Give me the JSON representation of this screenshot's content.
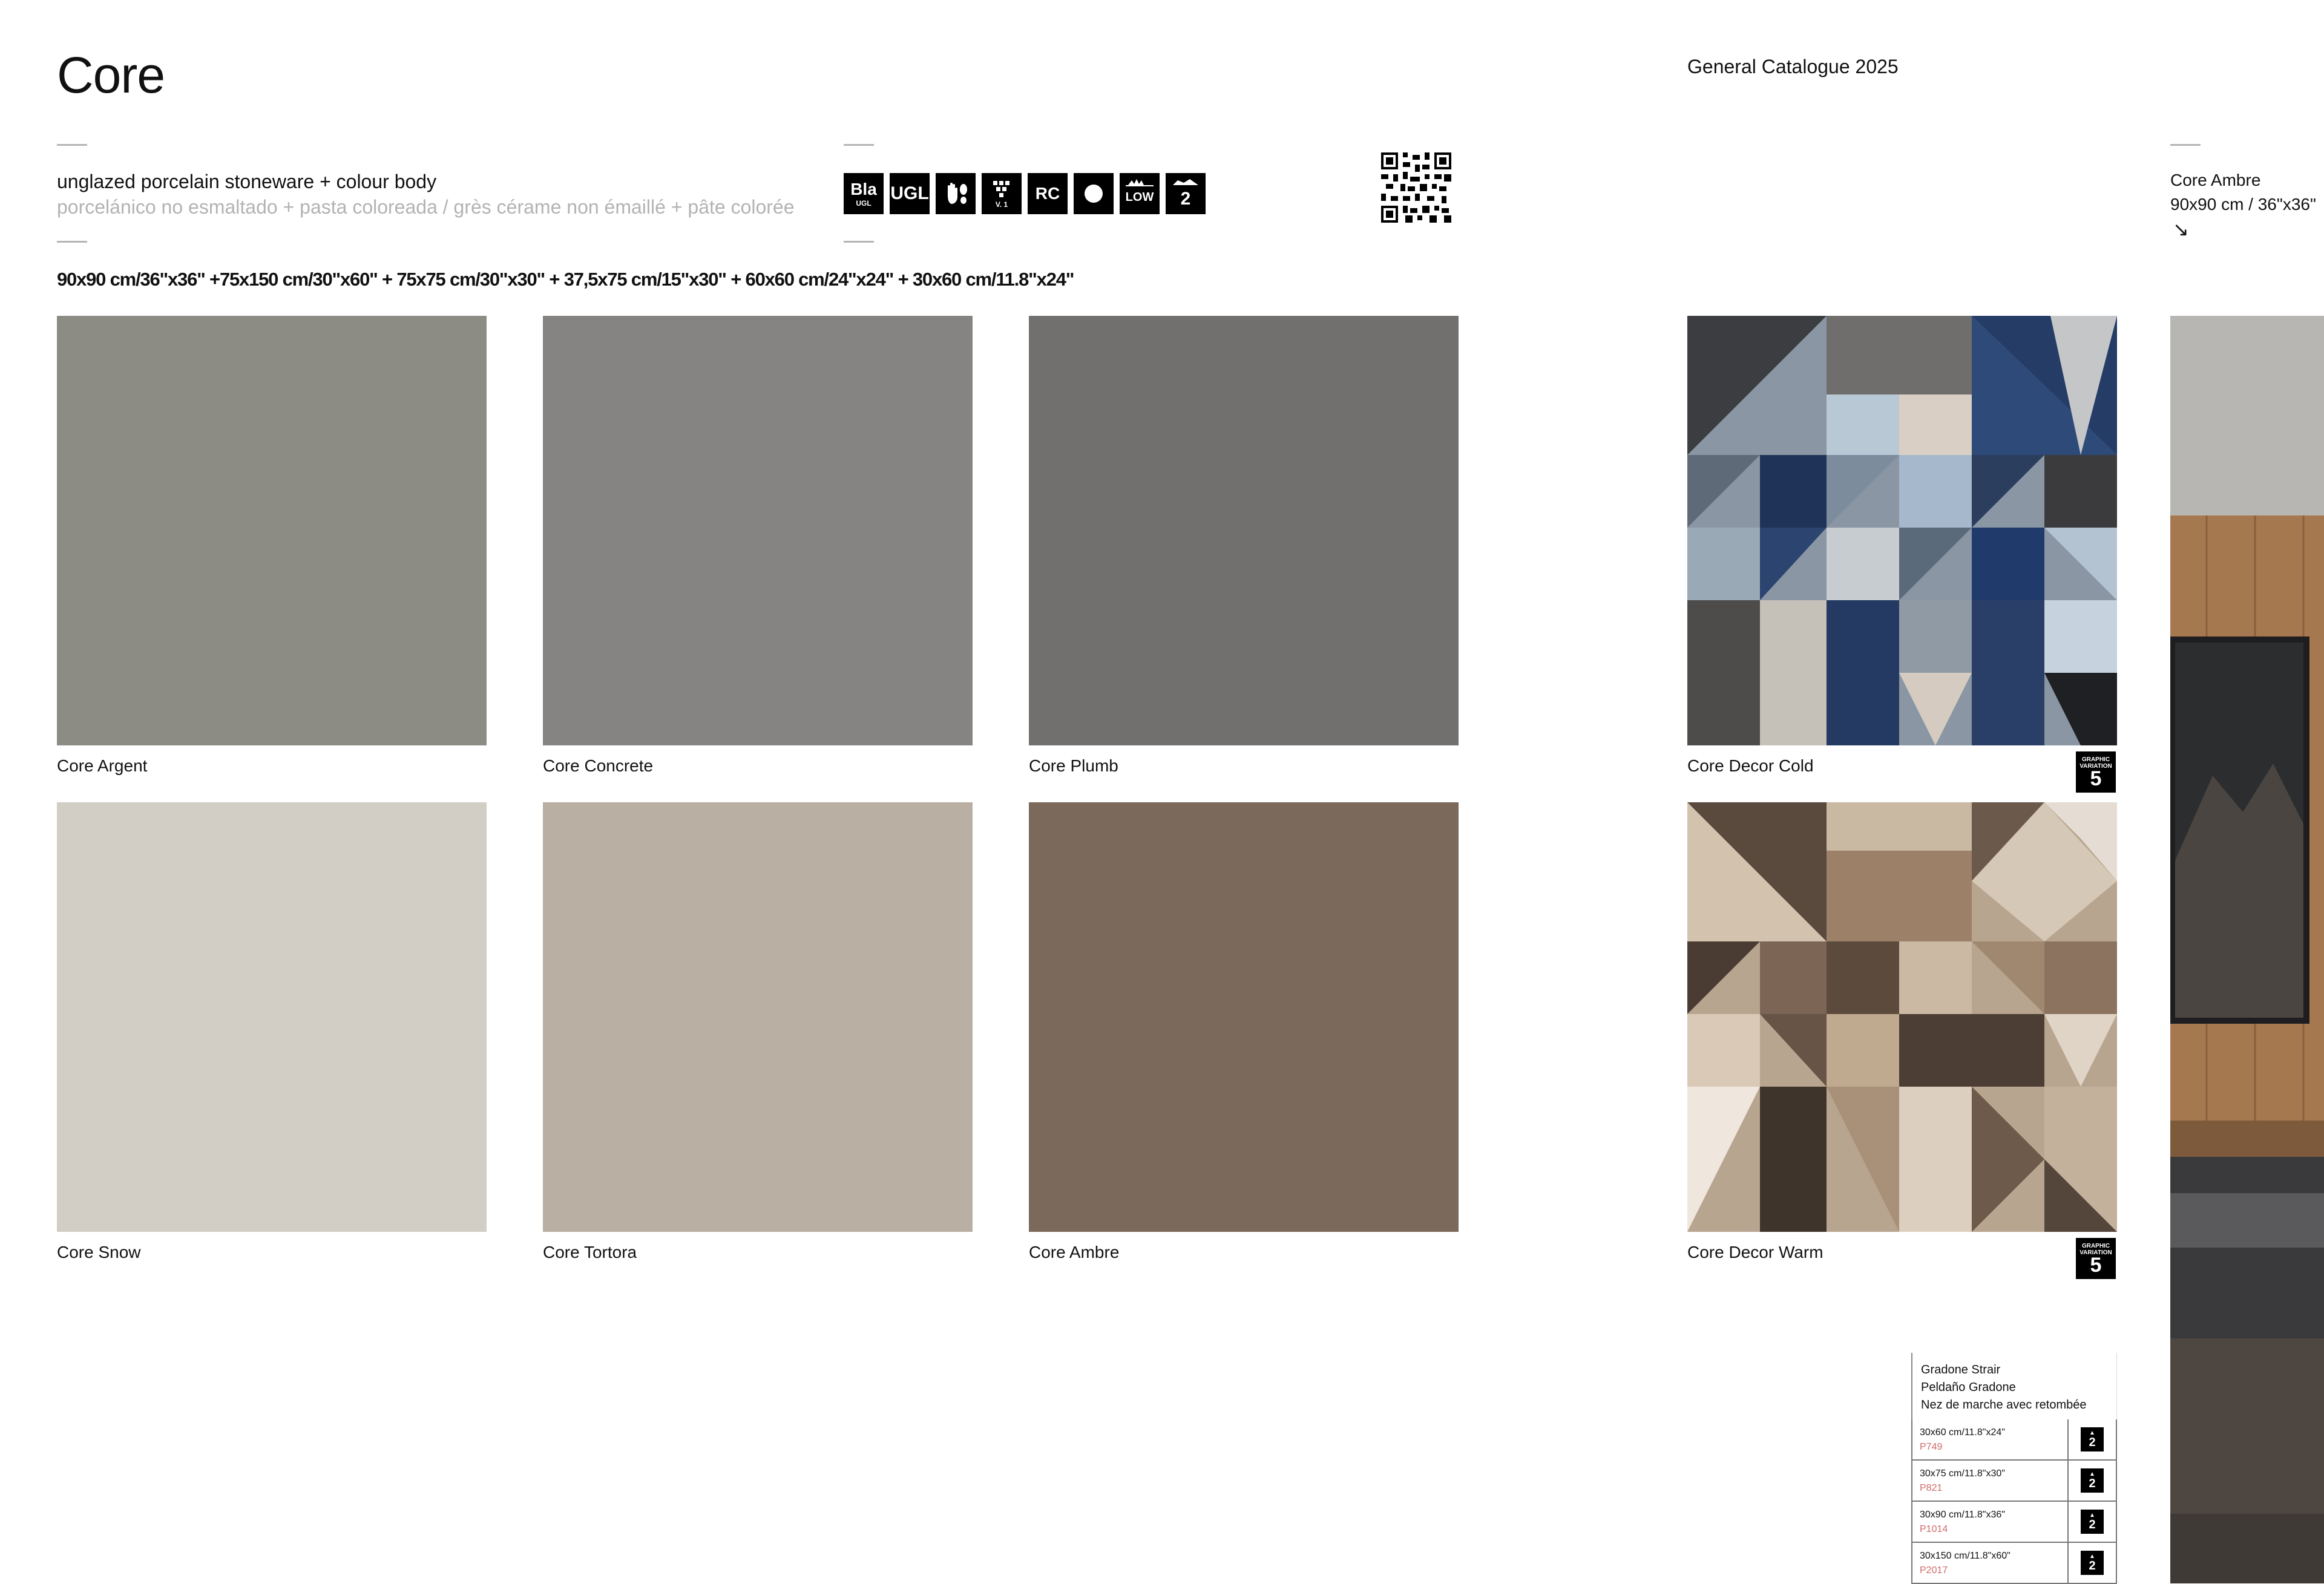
{
  "header": {
    "title": "Core",
    "catalogue": "General Catalogue 2025"
  },
  "subtitle": {
    "en": "unglazed porcelain stoneware + colour body",
    "other": "porcelánico no esmaltado + pasta coloreada / grès cérame non émaillé + pâte colorée"
  },
  "sizes": "90x90 cm/36\"x36\" +75x150 cm/30\"x60\" +  75x75 cm/30\"x30\" + 37,5x75 cm/15\"x30\" + 60x60 cm/24\"x24\" + 30x60 cm/11.8\"x24\"",
  "icons": [
    {
      "name": "bla-ugl-icon",
      "label": "Bla",
      "sub": "UGL"
    },
    {
      "name": "ugl-icon",
      "label": "UGL",
      "sub": ""
    },
    {
      "name": "hand-foot-icon",
      "label": "",
      "sub": ""
    },
    {
      "name": "shade-variation-icon",
      "label": "",
      "sub": "V. 1"
    },
    {
      "name": "rc-icon",
      "label": "RC",
      "sub": ""
    },
    {
      "name": "dot-icon",
      "label": "",
      "sub": ""
    },
    {
      "name": "low-icon",
      "label": "",
      "sub": "LOW"
    },
    {
      "name": "thickness-icon",
      "label": "2",
      "sub": ""
    }
  ],
  "tiles": [
    {
      "name": "Core Argent",
      "color": "#8d8c84"
    },
    {
      "name": "Core Concrete",
      "color": "#858483"
    },
    {
      "name": "Core Plumb",
      "color": "#71706e"
    },
    {
      "name": "Core Decor Cold",
      "color": "#5e6d80"
    },
    {
      "name": "Core Snow",
      "color": "#d2cdc5"
    },
    {
      "name": "Core Tortora",
      "color": "#b9b0a3"
    },
    {
      "name": "Core Ambre",
      "color": "#7b695b"
    },
    {
      "name": "Core Decor Warm",
      "color": "#a18a72"
    }
  ],
  "graphic_variation": {
    "text_top": "GRAPHIC",
    "text_bottom": "VARIATION",
    "number": "5"
  },
  "side": {
    "name": "Core Ambre",
    "size": "90x90 cm / 36\"x36\"",
    "arrow": "↘"
  },
  "stair": {
    "title_en": "Gradone Strair",
    "title_es": "Peldaño Gradone",
    "title_fr": "Nez de marche avec retombée",
    "rows": [
      {
        "size": "30x60 cm/11.8\"x24\"",
        "code": "P749",
        "badge": "2"
      },
      {
        "size": "30x75 cm/11.8\"x30\"",
        "code": "P821",
        "badge": "2"
      },
      {
        "size": "30x90 cm/11.8\"x36\"",
        "code": "P1014",
        "badge": "2"
      },
      {
        "size": "30x150 cm/11.8\"x60\"",
        "code": "P2017",
        "badge": "2"
      }
    ]
  }
}
